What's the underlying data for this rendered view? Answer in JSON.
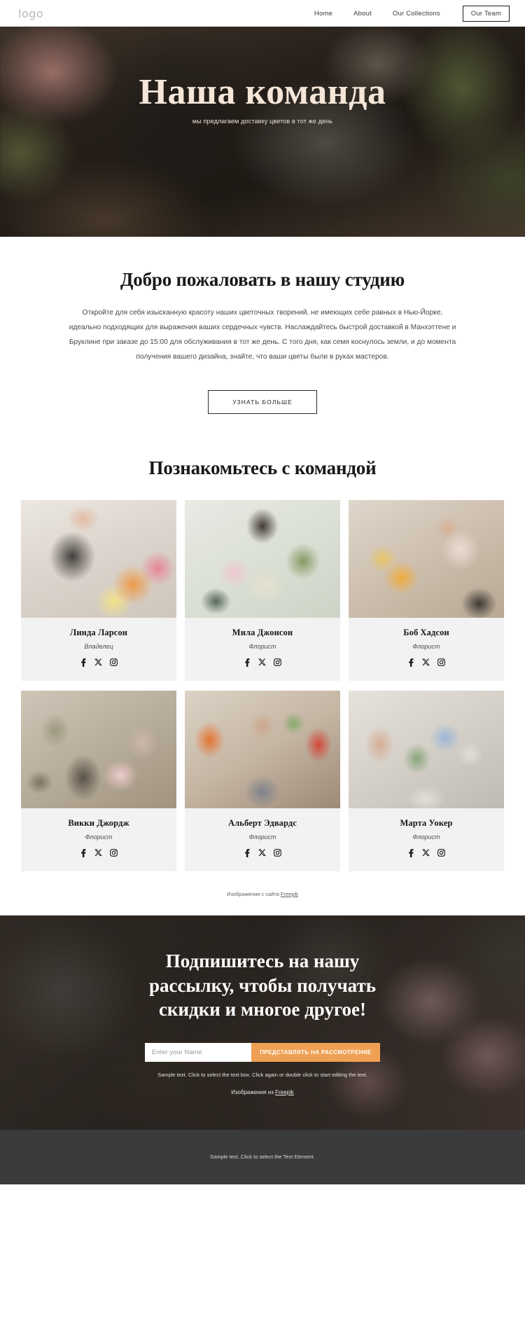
{
  "header": {
    "logo": "logo",
    "nav": [
      {
        "label": "Home",
        "boxed": false
      },
      {
        "label": "About",
        "boxed": false
      },
      {
        "label": "Our Collections",
        "boxed": false
      },
      {
        "label": "Our Team",
        "boxed": true
      }
    ]
  },
  "hero": {
    "title": "Наша команда",
    "subtitle": "мы предлагаем доставку цветов в тот же день"
  },
  "welcome": {
    "title": "Добро пожаловать в нашу студию",
    "paragraph": "Откройте для себя изысканную красоту наших цветочных творений, не имеющих себе равных в Нью-Йорке, идеально подходящих для выражения ваших сердечных чувств. Наслаждайтесь быстрой доставкой в Манхэттене и Бруклине при заказе до 15:00 для обслуживания в тот же день. С того дня, как семя коснулось земли, и до момента получения вашего дизайна, знайте, что ваши цветы были в руках мастеров.",
    "button_label": "УЗНАТЬ БОЛЬШЕ"
  },
  "team": {
    "title": "Познакомьтесь с командой",
    "members": [
      {
        "name": "Линда Ларсон",
        "role": "Владелец"
      },
      {
        "name": "Мила Джонсон",
        "role": "Флорист"
      },
      {
        "name": "Боб Хадсон",
        "role": "Флорист"
      },
      {
        "name": "Викки Джордж",
        "role": "Флорист"
      },
      {
        "name": "Альберт Эдвардс",
        "role": "Флорист"
      },
      {
        "name": "Марта Уокер",
        "role": "Флорист"
      }
    ],
    "social_icons": [
      "facebook-icon",
      "x-twitter-icon",
      "instagram-icon"
    ],
    "attribution_prefix": "Изображения с сайта ",
    "attribution_link": "Freepik"
  },
  "newsletter": {
    "title": "Подпишитесь на нашу рассылку, чтобы получать скидки и многое другое!",
    "input_placeholder": "Enter your Name",
    "input_value": "",
    "submit_label": "ПРЕДСТАВЛЯТЬ НА РАССМОТРЕНИЕ",
    "note": "Sample text. Click to select the text box. Click again or double click to start editing the text.",
    "attribution_prefix": "Изображения из ",
    "attribution_link": "Freepik",
    "accent_color": "#efa053"
  },
  "footer": {
    "text": "Sample text. Click to select the Text Element."
  }
}
